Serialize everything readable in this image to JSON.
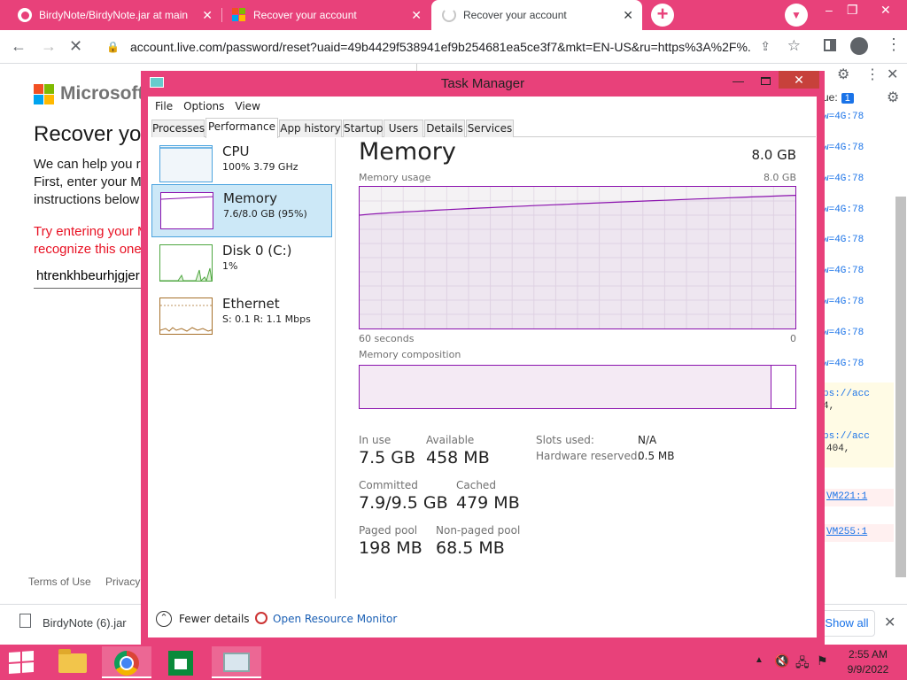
{
  "browser": {
    "tabs": [
      {
        "title": "BirdyNote/BirdyNote.jar at main",
        "favicon": "github-icon"
      },
      {
        "title": "Recover your account",
        "favicon": "microsoft-icon"
      },
      {
        "title": "Recover your account",
        "favicon": "loading-spinner-icon"
      }
    ],
    "active_tab_index": 2,
    "address": "account.live.com/password/reset?uaid=49b4429f538941ef9b254681ea5ce3f7&mkt=EN-US&ru=https%3A%2F%...",
    "accent_color": "#e8417a"
  },
  "page": {
    "logo_text": "Microsoft",
    "title": "Recover yo",
    "description": "We can help you r\nFirst, enter your M\ninstructions below",
    "error": "Try entering your M\nrecognize this one",
    "input_value": "htrenkhbeurhjgjer",
    "footer_terms": "Terms of Use",
    "footer_privacy": "Privacy"
  },
  "devtools": {
    "issues_label": "ue:",
    "issues_count": "1",
    "log_lines": [
      "w=4G:78",
      "w=4G:78",
      "w=4G:78",
      "w=4G:78",
      "w=4G:78",
      "w=4G:78",
      "w=4G:78",
      "w=4G:78",
      "w=4G:78"
    ],
    "url_fragment_1": "ps://acc",
    "url_fragment_1b": "4,",
    "url_fragment_2": "ps://acc",
    "url_fragment_2b": "404,",
    "vm_link_1": "VM221:1",
    "vm_link_2": "VM255:1"
  },
  "download_bar": {
    "filename": "BirdyNote (6).jar",
    "show_all": "Show all"
  },
  "task_manager": {
    "title": "Task Manager",
    "menu": [
      "File",
      "Options",
      "View"
    ],
    "tabs": [
      "Processes",
      "Performance",
      "App history",
      "Startup",
      "Users",
      "Details",
      "Services"
    ],
    "active_tab": "Performance",
    "resources": [
      {
        "name": "CPU",
        "detail": "100% 3.79 GHz"
      },
      {
        "name": "Memory",
        "detail": "7.6/8.0 GB (95%)"
      },
      {
        "name": "Disk 0 (C:)",
        "detail": "1%"
      },
      {
        "name": "Ethernet",
        "detail": "S: 0.1  R: 1.1 Mbps"
      }
    ],
    "selected_resource": "Memory",
    "memory": {
      "title": "Memory",
      "total": "8.0 GB",
      "usage_label": "Memory usage",
      "usage_max": "8.0 GB",
      "axis_left": "60 seconds",
      "axis_right": "0",
      "composition_label": "Memory composition",
      "usage_fraction_start": 0.8,
      "usage_fraction_end": 0.94,
      "composition_in_use_fraction": 0.945,
      "stats": {
        "in_use_label": "In use",
        "in_use": "7.5 GB",
        "available_label": "Available",
        "available": "458 MB",
        "committed_label": "Committed",
        "committed": "7.9/9.5 GB",
        "cached_label": "Cached",
        "cached": "479 MB",
        "paged_pool_label": "Paged pool",
        "paged_pool": "198 MB",
        "non_paged_pool_label": "Non-paged pool",
        "non_paged_pool": "68.5 MB",
        "slots_used_label": "Slots used:",
        "slots_used": "N/A",
        "hardware_reserved_label": "Hardware reserved:",
        "hardware_reserved": "0.5 MB"
      }
    },
    "fewer_details": "Fewer details",
    "open_resource_monitor": "Open Resource Monitor",
    "graph_color": "#8b12ae"
  },
  "taskbar": {
    "time": "2:55 AM",
    "date": "9/9/2022",
    "apps": [
      "file-explorer-icon",
      "chrome-icon",
      "store-icon",
      "task-manager-icon"
    ]
  }
}
